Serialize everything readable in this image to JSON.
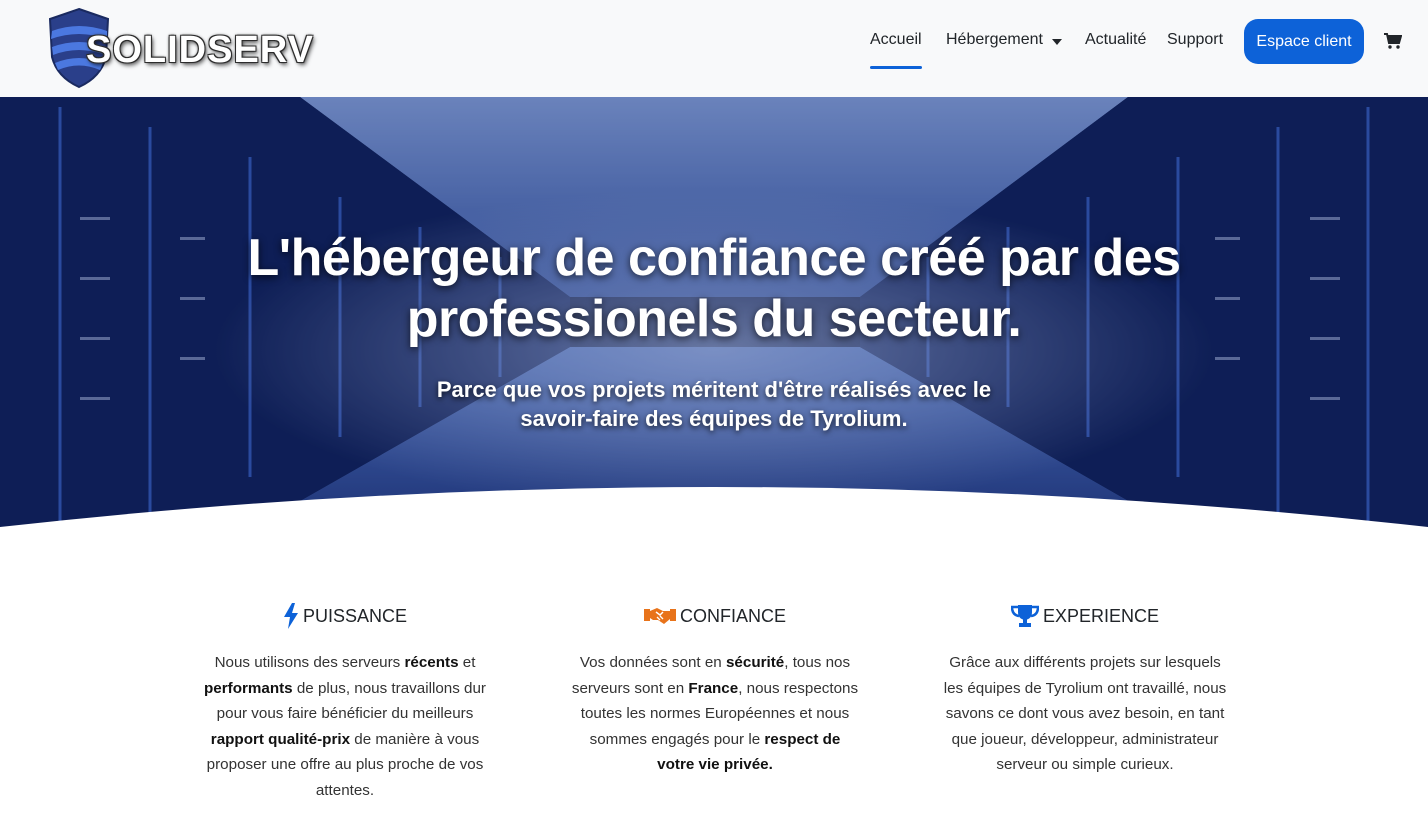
{
  "brand": {
    "name": "SOLIDSERV",
    "accent": "#0d62d8"
  },
  "nav": {
    "items": [
      "Accueil",
      "Hébergement",
      "Actualité",
      "Support"
    ],
    "active": "Accueil",
    "client_button": "Espace client",
    "cart_icon": "shopping-cart-icon"
  },
  "hero": {
    "title": "L'hébergeur de confiance créé par des professionels du secteur.",
    "subtitle": "Parce que vos projets méritent d'être réalisés avec le savoir-faire des équipes de Tyrolium."
  },
  "features": [
    {
      "icon": "lightning-bolt-icon",
      "icon_color": "#0d62d8",
      "title": "PUISSANCE",
      "text": [
        {
          "t": "Nous utilisons des serveurs "
        },
        {
          "t": "récents",
          "b": true
        },
        {
          "t": " et "
        },
        {
          "t": "performants",
          "b": true
        },
        {
          "t": " de plus, nous travaillons dur pour vous faire bénéficier du meilleurs "
        },
        {
          "t": "rapport qualité-prix",
          "b": true
        },
        {
          "t": " de manière à vous proposer une offre au plus proche de vos attentes."
        }
      ]
    },
    {
      "icon": "handshake-icon",
      "icon_color": "#e8731a",
      "title": "CONFIANCE",
      "text": [
        {
          "t": "Vos données sont en "
        },
        {
          "t": "sécurité",
          "b": true
        },
        {
          "t": ", tous nos serveurs sont en "
        },
        {
          "t": "France",
          "b": true
        },
        {
          "t": ", nous respectons toutes les normes Européennes et nous sommes engagés pour le "
        },
        {
          "t": "respect de votre vie privée.",
          "b": true
        }
      ]
    },
    {
      "icon": "trophy-icon",
      "icon_color": "#0d62d8",
      "title": "EXPERIENCE",
      "text": [
        {
          "t": "Grâce aux différents projets sur lesquels les équipes de Tyrolium ont travaillé, nous savons ce dont vous avez besoin, en tant que joueur, développeur, administrateur serveur ou simple curieux."
        }
      ]
    }
  ]
}
